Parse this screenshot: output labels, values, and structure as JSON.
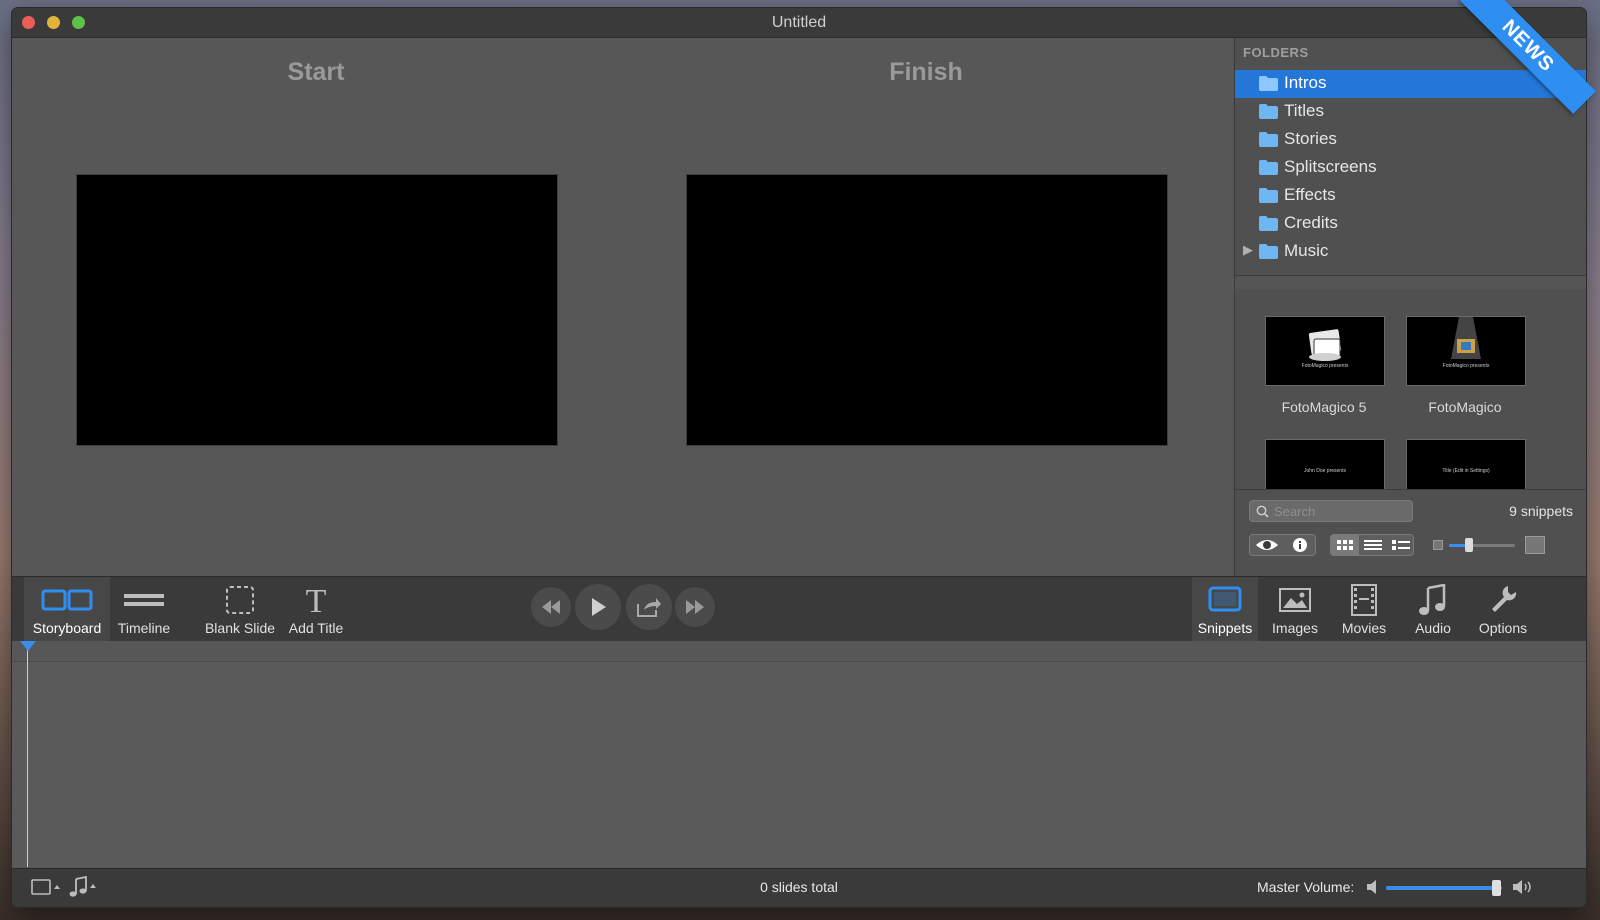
{
  "window": {
    "title": "Untitled"
  },
  "preview": {
    "start_label": "Start",
    "finish_label": "Finish"
  },
  "sidebar": {
    "header": "FOLDERS",
    "folders": [
      {
        "label": "Intros",
        "selected": true
      },
      {
        "label": "Titles"
      },
      {
        "label": "Stories"
      },
      {
        "label": "Splitscreens"
      },
      {
        "label": "Effects"
      },
      {
        "label": "Credits"
      },
      {
        "label": "Music",
        "expandable": true
      }
    ],
    "snippets": [
      {
        "caption": "FotoMagico 5",
        "thumb_text": "FotoMagico presents"
      },
      {
        "caption": "FotoMagico",
        "thumb_text": "FotoMagico presents"
      },
      {
        "caption": "",
        "thumb_text": "John Doe presents"
      },
      {
        "caption": "",
        "thumb_text": "Title (Edit in Settings)"
      }
    ],
    "search_placeholder": "Search",
    "snippet_count": "9 snippets",
    "thumb_size_level": 0.3
  },
  "toolbar": {
    "left": [
      {
        "label": "Storyboard",
        "icon": "storyboard-icon",
        "active": true
      },
      {
        "label": "Timeline",
        "icon": "timeline-icon"
      },
      {
        "label": "Blank Slide",
        "icon": "blank-slide-icon"
      },
      {
        "label": "Add Title",
        "icon": "add-title-icon"
      }
    ],
    "transport": [
      "rewind-icon",
      "play-icon",
      "share-icon",
      "fast-forward-icon"
    ],
    "right": [
      {
        "label": "Snippets",
        "icon": "snippets-icon",
        "active": true
      },
      {
        "label": "Images",
        "icon": "images-icon"
      },
      {
        "label": "Movies",
        "icon": "movies-icon"
      },
      {
        "label": "Audio",
        "icon": "audio-icon"
      },
      {
        "label": "Options",
        "icon": "options-icon"
      }
    ]
  },
  "status": {
    "slides_total": "0 slides total",
    "master_volume_label": "Master Volume:",
    "master_volume_level": 0.95
  },
  "badge": {
    "text": "NEWS"
  },
  "colors": {
    "accent": "#2477d9",
    "window_bg": "#575757",
    "toolbar_bg": "#3a3a3a"
  }
}
